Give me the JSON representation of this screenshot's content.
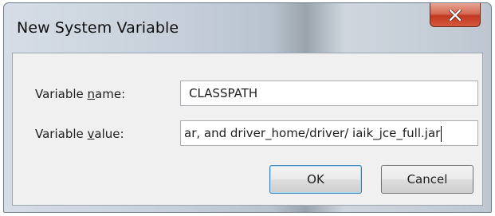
{
  "dialog": {
    "title": "New System Variable"
  },
  "fields": {
    "name_label_pre": "Variable ",
    "name_label_u": "n",
    "name_label_post": "ame:",
    "name_value": "CLASSPATH",
    "value_label_pre": "Variable ",
    "value_label_u": "v",
    "value_label_post": "alue:",
    "value_value": "ar, and driver_home/driver/ iaik_jce_full.jar"
  },
  "buttons": {
    "ok": "OK",
    "cancel": "Cancel"
  },
  "icons": {
    "close": "close-icon"
  }
}
